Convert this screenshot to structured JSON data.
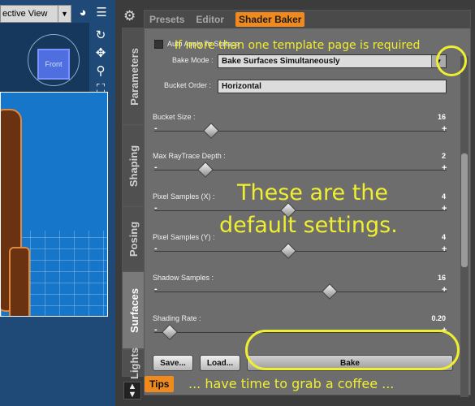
{
  "viewport": {
    "view_label": "ective View",
    "dropdown_arrow": "▼",
    "cube_label": "Front"
  },
  "panel": {
    "top_tabs": [
      "Presets",
      "Editor",
      "Shader Baker"
    ],
    "active_top_tab": "Shader Baker",
    "side_tabs": [
      "Parameters",
      "Shaping",
      "Posing",
      "Surfaces",
      "Lights"
    ],
    "active_side_tab": "Surfaces"
  },
  "settings": {
    "auto_apply_label": "Auto Apply To Surface",
    "bake_mode_label": "Bake Mode :",
    "bake_mode_value": "Bake Surfaces Simultaneously",
    "bucket_order_label": "Bucket Order :",
    "bucket_order_value": "Horizontal",
    "sliders": [
      {
        "label": "Bucket Size :",
        "value": "16",
        "level": 0.17
      },
      {
        "label": "Max RayTrace Depth :",
        "value": "2",
        "level": 0.15
      },
      {
        "label": "Pixel Samples (X) :",
        "value": "4",
        "level": 0.45
      },
      {
        "label": "Pixel Samples (Y) :",
        "value": "4",
        "level": 0.45
      },
      {
        "label": "Shadow Samples :",
        "value": "16",
        "level": 0.6
      },
      {
        "label": "Shading Rate :",
        "value": "0.20",
        "level": 0.02
      }
    ],
    "save_label": "Save...",
    "load_label": "Load...",
    "bake_label": "Bake",
    "tips_label": "Tips"
  },
  "annotations": {
    "top_note": "If more than one template page is required",
    "middle_note_line1": "These are the",
    "middle_note_line2": "default settings.",
    "bottom_note": "... have time to grab a coffee ..."
  },
  "colors": {
    "accent": "#f08a1e",
    "annotation": "#f0ee30",
    "viewport_bg": "#1676c9"
  }
}
